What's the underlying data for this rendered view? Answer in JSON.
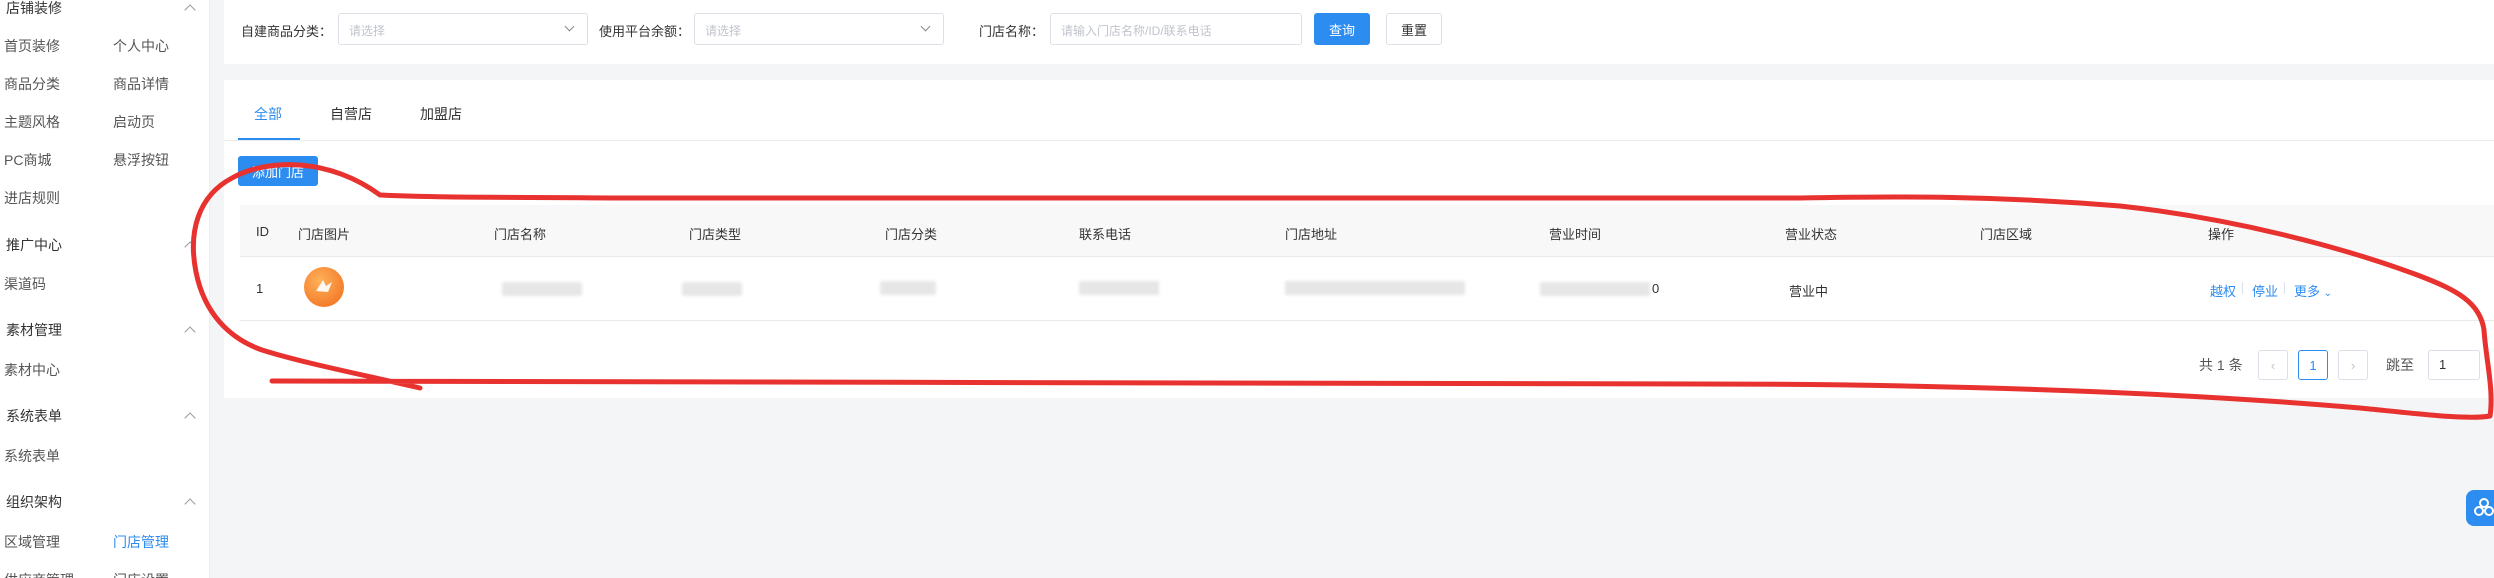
{
  "sidebar": {
    "groups": [
      {
        "title": "店铺装修",
        "items": [
          "首页装修",
          "个人中心",
          "商品分类",
          "商品详情",
          "主题风格",
          "启动页",
          "PC商城",
          "悬浮按钮",
          "进店规则"
        ]
      },
      {
        "title": "推广中心",
        "items": [
          "渠道码"
        ]
      },
      {
        "title": "素材管理",
        "items": [
          "素材中心"
        ]
      },
      {
        "title": "系统表单",
        "items": [
          "系统表单"
        ]
      },
      {
        "title": "组织架构",
        "items": [
          "区域管理",
          "门店管理",
          "供应商管理",
          "门店设置"
        ]
      }
    ],
    "active_item": "门店管理"
  },
  "filters": {
    "category_label": "自建商品分类：",
    "category_placeholder": "请选择",
    "balance_label": "使用平台余额：",
    "balance_placeholder": "请选择",
    "store_name_label": "门店名称：",
    "store_name_placeholder": "请输入门店名称/ID/联系电话",
    "query_button": "查询",
    "reset_button": "重置"
  },
  "tabs": [
    "全部",
    "自营店",
    "加盟店"
  ],
  "add_store_button": "添加门店",
  "table": {
    "columns": [
      "ID",
      "门店图片",
      "门店名称",
      "门店类型",
      "门店分类",
      "联系电话",
      "门店地址",
      "营业时间",
      "营业状态",
      "门店区域",
      "操作"
    ],
    "rows": [
      {
        "id": "1",
        "name": "",
        "type": "",
        "category": "",
        "phone": "",
        "address": "",
        "hours_suffix": "0",
        "status": "营业中",
        "region": "",
        "actions": [
          "越权",
          "停业",
          "更多"
        ]
      }
    ]
  },
  "pagination": {
    "total_text": "共 1 条",
    "current_page": "1",
    "jump_label": "跳至",
    "jump_value": "1"
  },
  "colors": {
    "accent": "#2d8cf0",
    "annotation": "#e8322f"
  }
}
